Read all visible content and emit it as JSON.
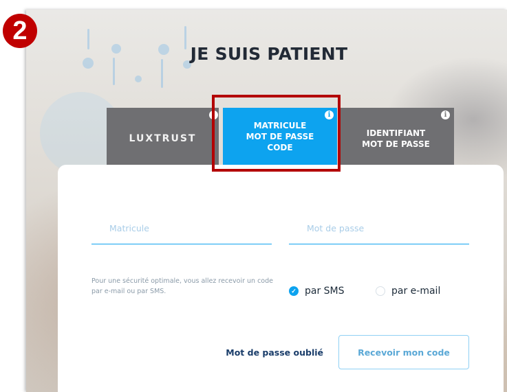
{
  "step_badge": "2",
  "page_title": "JE SUIS PATIENT",
  "tabs": [
    {
      "label": "LUXTRUST",
      "info_icon": "info-icon"
    },
    {
      "label_lines": [
        "MATRICULE",
        "MOT DE PASSE",
        "CODE"
      ],
      "info_icon": "info-icon",
      "active": true
    },
    {
      "label_lines": [
        "IDENTIFIANT",
        "MOT DE PASSE"
      ],
      "info_icon": "info-icon"
    }
  ],
  "form": {
    "matricule_placeholder": "Matricule",
    "password_placeholder": "Mot de passe",
    "security_note": "Pour une sécurité optimale, vous allez recevoir un code par e-mail ou par SMS.",
    "radio_sms": {
      "label": "par SMS",
      "checked": true
    },
    "radio_email": {
      "label": "par e-mail",
      "checked": false
    },
    "forgot_password": "Mot de passe oublié",
    "submit_button": "Recevoir mon code"
  },
  "colors": {
    "accent": "#0da3ef",
    "tab_inactive": "#6f6f72",
    "highlight": "#b30000",
    "badge": "#c00000",
    "title": "#222a36"
  }
}
